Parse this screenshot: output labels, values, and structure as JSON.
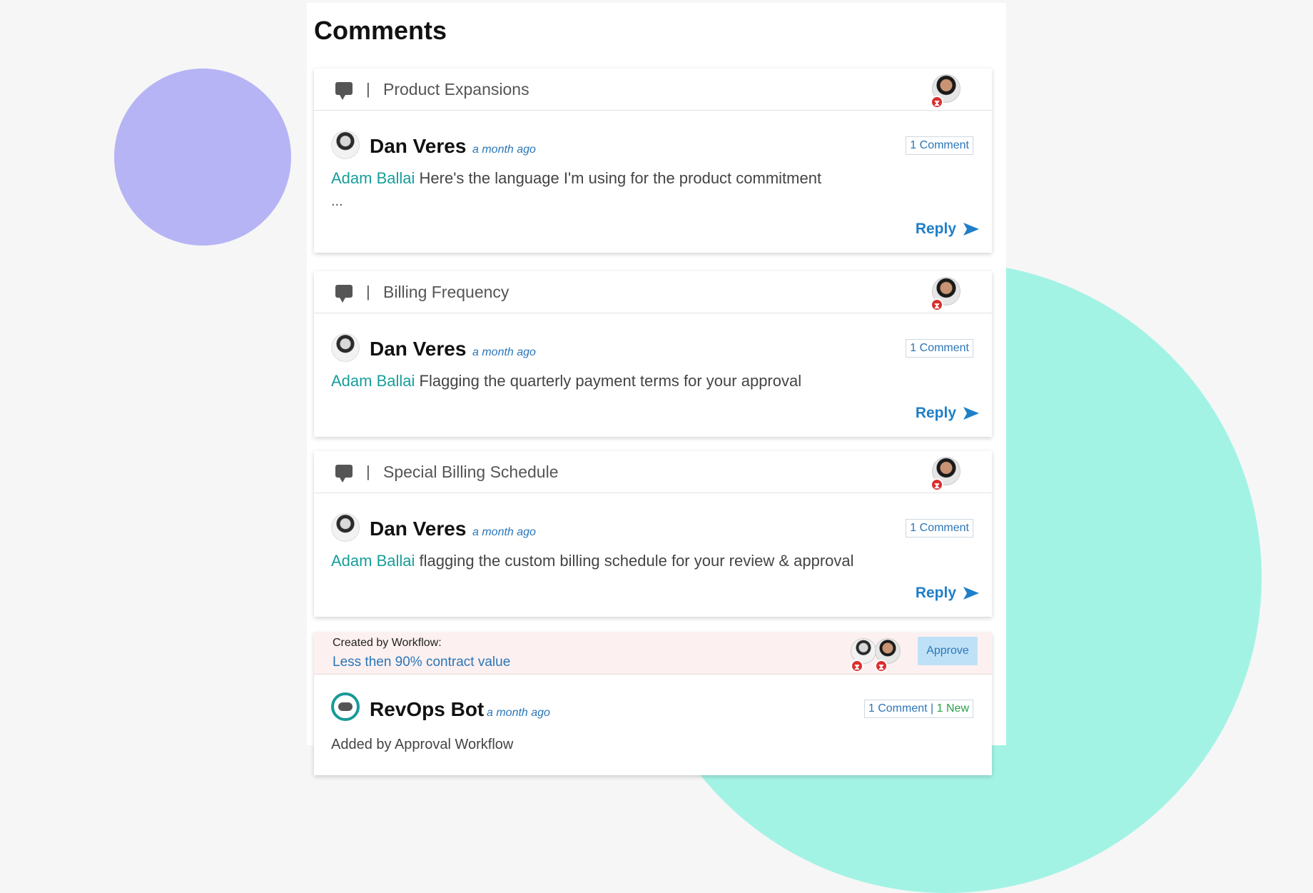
{
  "panel": {
    "title": "Comments"
  },
  "threads": [
    {
      "topic": "Product Expansions",
      "author": "Dan Veres",
      "time": "a month ago",
      "count": "1 Comment",
      "mention": "Adam Ballai",
      "text": "Here's the language I'm using for the product commitment",
      "ellipsis": "...",
      "reply": "Reply"
    },
    {
      "topic": "Billing Frequency",
      "author": "Dan Veres",
      "time": "a month ago",
      "count": "1 Comment",
      "mention": "Adam Ballai",
      "text": "Flagging the quarterly payment terms for your approval",
      "reply": "Reply"
    },
    {
      "topic": "Special Billing Schedule",
      "author": "Dan Veres",
      "time": "a month ago",
      "count": "1 Comment",
      "mention": "Adam Ballai",
      "text": "flagging the custom billing schedule for your review & approval",
      "reply": "Reply"
    }
  ],
  "workflow": {
    "label": "Created by Workflow:",
    "rule": "Less then 90% contract value",
    "approve": "Approve",
    "author": "RevOps Bot",
    "time": "a month ago",
    "count": "1 Comment",
    "count_sep": "|",
    "new_count": "1 New",
    "cut_text": "Added by Approval Workflow"
  },
  "colors": {
    "accent_blue": "#2a76b8",
    "mention_teal": "#179e9a",
    "approve_bg": "#bfe1f7",
    "decor_purple": "#b6b4f5",
    "decor_teal": "#a3f3e5"
  }
}
